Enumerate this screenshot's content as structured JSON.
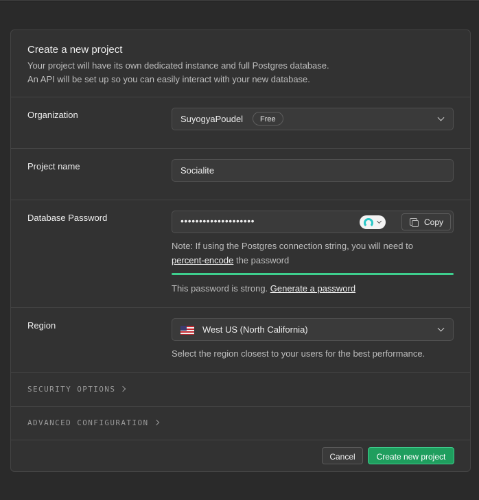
{
  "dialog": {
    "title": "Create a new project",
    "description_line1": "Your project will have its own dedicated instance and full Postgres database.",
    "description_line2": "An API will be set up so you can easily interact with your new database."
  },
  "organization": {
    "label": "Organization",
    "value": "SuyogyaPoudel",
    "plan_badge": "Free"
  },
  "project_name": {
    "label": "Project name",
    "value": "Socialite"
  },
  "database_password": {
    "label": "Database Password",
    "masked_value": "••••••••••••••••••••",
    "copy_label": "Copy",
    "note_prefix": "Note: If using the Postgres connection string, you will need to",
    "note_link": "percent-encode",
    "note_suffix": "the password",
    "strength_text": "This password is strong.",
    "generate_link": "Generate a password",
    "strength_level": 1.0,
    "strength_color": "#3ecf8e"
  },
  "region": {
    "label": "Region",
    "value": "West US (North California)",
    "flag_icon": "us-flag-icon",
    "helper": "Select the region closest to your users for the best performance."
  },
  "sections": {
    "security": "SECURITY OPTIONS",
    "advanced": "ADVANCED CONFIGURATION"
  },
  "footer": {
    "cancel_label": "Cancel",
    "create_label": "Create new project",
    "accent_color": "#3ecf8e"
  }
}
